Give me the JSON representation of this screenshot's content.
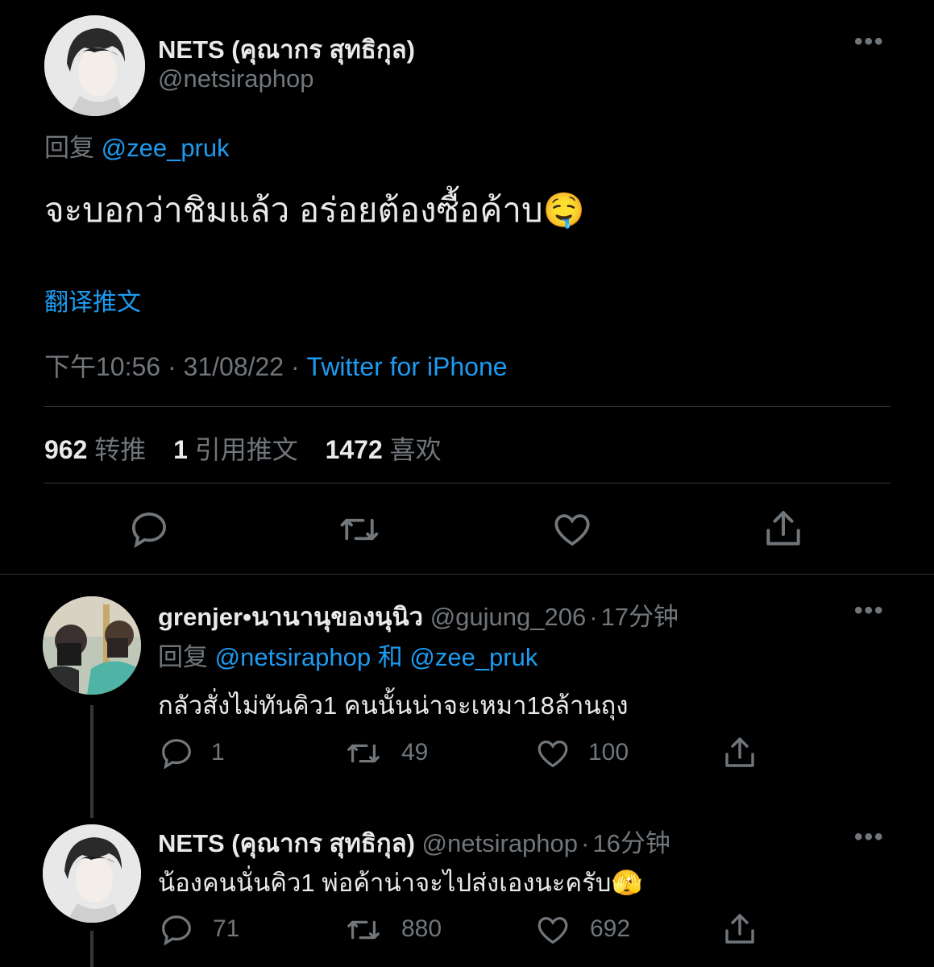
{
  "main_tweet": {
    "display_name": "NETS (คุณากร สุทธิกุล)",
    "handle": "@netsiraphop",
    "reply_prefix": "回复",
    "reply_to": "@zee_pruk",
    "text": "จะบอกว่าชิมแล้ว อร่อยต้องซื้อค้าบ",
    "emoji": "🤤",
    "translate_label": "翻译推文",
    "time": "下午10:56",
    "date": "31/08/22",
    "separator": "·",
    "source": "Twitter for iPhone",
    "stats": {
      "retweets_count": "962",
      "retweets_label": "转推",
      "quotes_count": "1",
      "quotes_label": "引用推文",
      "likes_count": "1472",
      "likes_label": "喜欢"
    }
  },
  "replies": [
    {
      "display_name": "grenjer•นานานุของนุนิว",
      "handle": "@gujung_206",
      "time": "17分钟",
      "reply_prefix": "回复",
      "reply_to_1": "@netsiraphop",
      "reply_and": "和",
      "reply_to_2": "@zee_pruk",
      "text": "กลัวสั่งไม่ทันคิว1 คนนั้นน่าจะเหมา18ล้านถุง",
      "reply_count": "1",
      "retweet_count": "49",
      "like_count": "100"
    },
    {
      "display_name": "NETS (คุณากร สุทธิกุล)",
      "handle": "@netsiraphop",
      "time": "16分钟",
      "text": "น้องคนนั่นคิว1 พ่อค้าน่าจะไปส่งเองนะครับ",
      "emoji": "🫣",
      "reply_count": "71",
      "retweet_count": "880",
      "like_count": "692"
    }
  ],
  "colors": {
    "background": "#000000",
    "text": "#e7e9ea",
    "secondary": "#71767b",
    "link": "#1d9bf0",
    "divider": "#2f3336"
  }
}
